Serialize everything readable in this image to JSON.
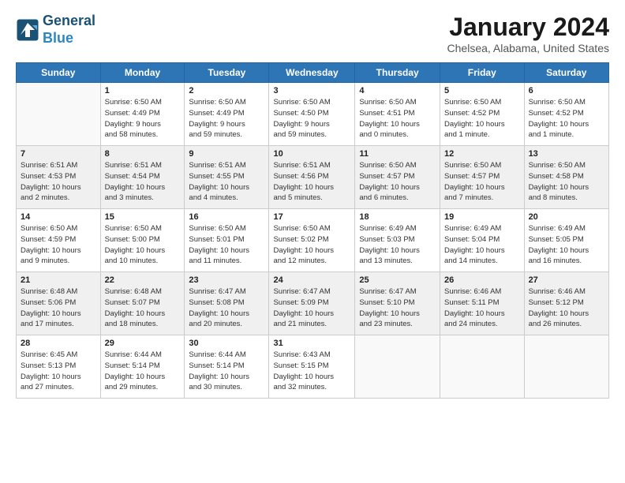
{
  "logo": {
    "line1": "General",
    "line2": "Blue"
  },
  "title": "January 2024",
  "subtitle": "Chelsea, Alabama, United States",
  "weekdays": [
    "Sunday",
    "Monday",
    "Tuesday",
    "Wednesday",
    "Thursday",
    "Friday",
    "Saturday"
  ],
  "weeks": [
    [
      {
        "day": "",
        "info": ""
      },
      {
        "day": "1",
        "info": "Sunrise: 6:50 AM\nSunset: 4:49 PM\nDaylight: 9 hours\nand 58 minutes."
      },
      {
        "day": "2",
        "info": "Sunrise: 6:50 AM\nSunset: 4:49 PM\nDaylight: 9 hours\nand 59 minutes."
      },
      {
        "day": "3",
        "info": "Sunrise: 6:50 AM\nSunset: 4:50 PM\nDaylight: 9 hours\nand 59 minutes."
      },
      {
        "day": "4",
        "info": "Sunrise: 6:50 AM\nSunset: 4:51 PM\nDaylight: 10 hours\nand 0 minutes."
      },
      {
        "day": "5",
        "info": "Sunrise: 6:50 AM\nSunset: 4:52 PM\nDaylight: 10 hours\nand 1 minute."
      },
      {
        "day": "6",
        "info": "Sunrise: 6:50 AM\nSunset: 4:52 PM\nDaylight: 10 hours\nand 1 minute."
      }
    ],
    [
      {
        "day": "7",
        "info": "Sunrise: 6:51 AM\nSunset: 4:53 PM\nDaylight: 10 hours\nand 2 minutes."
      },
      {
        "day": "8",
        "info": "Sunrise: 6:51 AM\nSunset: 4:54 PM\nDaylight: 10 hours\nand 3 minutes."
      },
      {
        "day": "9",
        "info": "Sunrise: 6:51 AM\nSunset: 4:55 PM\nDaylight: 10 hours\nand 4 minutes."
      },
      {
        "day": "10",
        "info": "Sunrise: 6:51 AM\nSunset: 4:56 PM\nDaylight: 10 hours\nand 5 minutes."
      },
      {
        "day": "11",
        "info": "Sunrise: 6:50 AM\nSunset: 4:57 PM\nDaylight: 10 hours\nand 6 minutes."
      },
      {
        "day": "12",
        "info": "Sunrise: 6:50 AM\nSunset: 4:57 PM\nDaylight: 10 hours\nand 7 minutes."
      },
      {
        "day": "13",
        "info": "Sunrise: 6:50 AM\nSunset: 4:58 PM\nDaylight: 10 hours\nand 8 minutes."
      }
    ],
    [
      {
        "day": "14",
        "info": "Sunrise: 6:50 AM\nSunset: 4:59 PM\nDaylight: 10 hours\nand 9 minutes."
      },
      {
        "day": "15",
        "info": "Sunrise: 6:50 AM\nSunset: 5:00 PM\nDaylight: 10 hours\nand 10 minutes."
      },
      {
        "day": "16",
        "info": "Sunrise: 6:50 AM\nSunset: 5:01 PM\nDaylight: 10 hours\nand 11 minutes."
      },
      {
        "day": "17",
        "info": "Sunrise: 6:50 AM\nSunset: 5:02 PM\nDaylight: 10 hours\nand 12 minutes."
      },
      {
        "day": "18",
        "info": "Sunrise: 6:49 AM\nSunset: 5:03 PM\nDaylight: 10 hours\nand 13 minutes."
      },
      {
        "day": "19",
        "info": "Sunrise: 6:49 AM\nSunset: 5:04 PM\nDaylight: 10 hours\nand 14 minutes."
      },
      {
        "day": "20",
        "info": "Sunrise: 6:49 AM\nSunset: 5:05 PM\nDaylight: 10 hours\nand 16 minutes."
      }
    ],
    [
      {
        "day": "21",
        "info": "Sunrise: 6:48 AM\nSunset: 5:06 PM\nDaylight: 10 hours\nand 17 minutes."
      },
      {
        "day": "22",
        "info": "Sunrise: 6:48 AM\nSunset: 5:07 PM\nDaylight: 10 hours\nand 18 minutes."
      },
      {
        "day": "23",
        "info": "Sunrise: 6:47 AM\nSunset: 5:08 PM\nDaylight: 10 hours\nand 20 minutes."
      },
      {
        "day": "24",
        "info": "Sunrise: 6:47 AM\nSunset: 5:09 PM\nDaylight: 10 hours\nand 21 minutes."
      },
      {
        "day": "25",
        "info": "Sunrise: 6:47 AM\nSunset: 5:10 PM\nDaylight: 10 hours\nand 23 minutes."
      },
      {
        "day": "26",
        "info": "Sunrise: 6:46 AM\nSunset: 5:11 PM\nDaylight: 10 hours\nand 24 minutes."
      },
      {
        "day": "27",
        "info": "Sunrise: 6:46 AM\nSunset: 5:12 PM\nDaylight: 10 hours\nand 26 minutes."
      }
    ],
    [
      {
        "day": "28",
        "info": "Sunrise: 6:45 AM\nSunset: 5:13 PM\nDaylight: 10 hours\nand 27 minutes."
      },
      {
        "day": "29",
        "info": "Sunrise: 6:44 AM\nSunset: 5:14 PM\nDaylight: 10 hours\nand 29 minutes."
      },
      {
        "day": "30",
        "info": "Sunrise: 6:44 AM\nSunset: 5:14 PM\nDaylight: 10 hours\nand 30 minutes."
      },
      {
        "day": "31",
        "info": "Sunrise: 6:43 AM\nSunset: 5:15 PM\nDaylight: 10 hours\nand 32 minutes."
      },
      {
        "day": "",
        "info": ""
      },
      {
        "day": "",
        "info": ""
      },
      {
        "day": "",
        "info": ""
      }
    ]
  ]
}
